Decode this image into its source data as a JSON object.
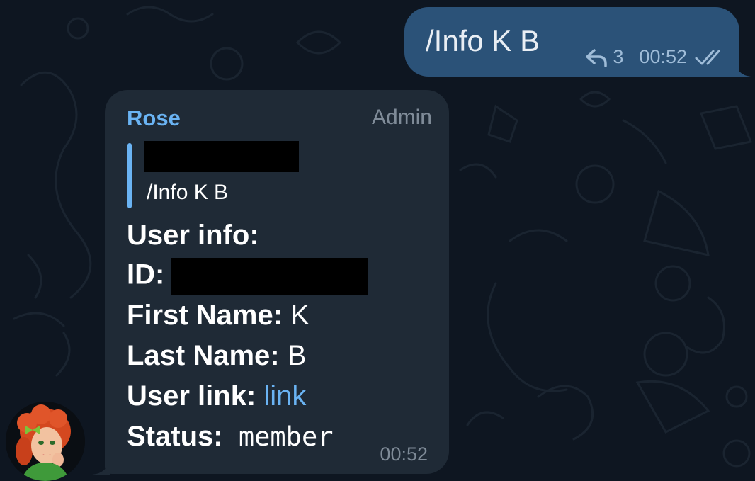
{
  "outgoing": {
    "text": "/Info K B",
    "reply_count": "3",
    "time": "00:52"
  },
  "incoming": {
    "sender": "Rose",
    "role": "Admin",
    "quote_text": "/Info K B",
    "lines": {
      "header": "User info:",
      "id_label": "ID:",
      "first_name_label": "First Name:",
      "first_name_value": " K",
      "last_name_label": "Last Name:",
      "last_name_value": " B",
      "user_link_label": "User link:",
      "user_link_value": " link",
      "status_label": "Status:",
      "status_value": " member"
    },
    "time": "00:52"
  },
  "colors": {
    "background": "#0e1621",
    "outgoing_bubble": "#2b5278",
    "incoming_bubble": "#1f2a36",
    "accent": "#6ab3f3"
  },
  "icons": [
    "reply-icon",
    "double-check-icon"
  ]
}
